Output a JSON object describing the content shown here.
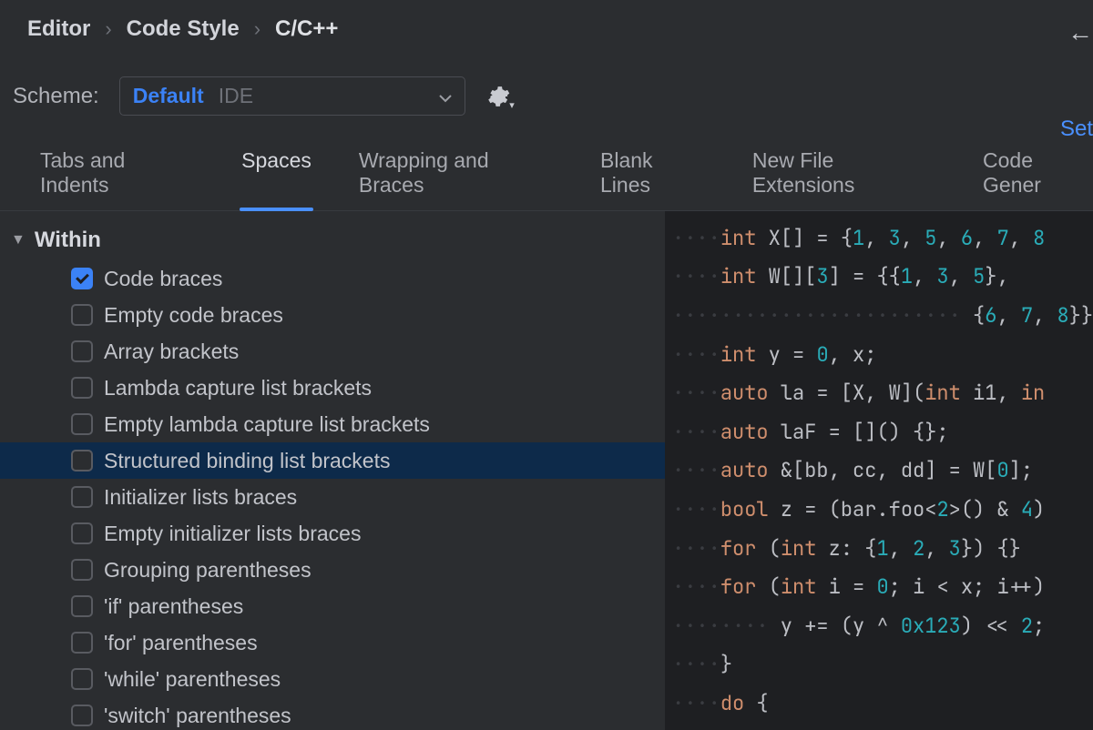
{
  "breadcrumb": [
    "Editor",
    "Code Style",
    "C/C++"
  ],
  "top_link": "Set",
  "scheme": {
    "label": "Scheme:",
    "primary": "Default",
    "secondary": "IDE"
  },
  "tabs": [
    {
      "label": "Tabs and Indents",
      "active": false
    },
    {
      "label": "Spaces",
      "active": true
    },
    {
      "label": "Wrapping and Braces",
      "active": false
    },
    {
      "label": "Blank Lines",
      "active": false
    },
    {
      "label": "New File Extensions",
      "active": false
    },
    {
      "label": "Code Gener",
      "active": false
    }
  ],
  "section_title": "Within",
  "options": [
    {
      "label": "Code braces",
      "checked": true,
      "selected": false
    },
    {
      "label": "Empty code braces",
      "checked": false,
      "selected": false
    },
    {
      "label": "Array brackets",
      "checked": false,
      "selected": false
    },
    {
      "label": "Lambda capture list brackets",
      "checked": false,
      "selected": false
    },
    {
      "label": "Empty lambda capture list brackets",
      "checked": false,
      "selected": false
    },
    {
      "label": "Structured binding list brackets",
      "checked": false,
      "selected": true
    },
    {
      "label": "Initializer lists braces",
      "checked": false,
      "selected": false
    },
    {
      "label": "Empty initializer lists braces",
      "checked": false,
      "selected": false
    },
    {
      "label": "Grouping parentheses",
      "checked": false,
      "selected": false
    },
    {
      "label": "'if' parentheses",
      "checked": false,
      "selected": false
    },
    {
      "label": "'for' parentheses",
      "checked": false,
      "selected": false
    },
    {
      "label": "'while' parentheses",
      "checked": false,
      "selected": false
    },
    {
      "label": "'switch' parentheses",
      "checked": false,
      "selected": false
    }
  ],
  "code": [
    {
      "indent": 1,
      "tokens": [
        [
          "kw",
          "int"
        ],
        [
          "txt",
          " X[] = {"
        ],
        [
          "num",
          "1"
        ],
        [
          "txt",
          ", "
        ],
        [
          "num",
          "3"
        ],
        [
          "txt",
          ", "
        ],
        [
          "num",
          "5"
        ],
        [
          "txt",
          ", "
        ],
        [
          "num",
          "6"
        ],
        [
          "txt",
          ", "
        ],
        [
          "num",
          "7"
        ],
        [
          "txt",
          ", "
        ],
        [
          "num",
          "8"
        ]
      ]
    },
    {
      "indent": 1,
      "tokens": [
        [
          "kw",
          "int"
        ],
        [
          "txt",
          " W[]["
        ],
        [
          "num",
          "3"
        ],
        [
          "txt",
          "] = {{"
        ],
        [
          "num",
          "1"
        ],
        [
          "txt",
          ", "
        ],
        [
          "num",
          "3"
        ],
        [
          "txt",
          ", "
        ],
        [
          "num",
          "5"
        ],
        [
          "txt",
          "},"
        ]
      ]
    },
    {
      "indent": 6,
      "tokens": [
        [
          "txt",
          " {"
        ],
        [
          "num",
          "6"
        ],
        [
          "txt",
          ", "
        ],
        [
          "num",
          "7"
        ],
        [
          "txt",
          ", "
        ],
        [
          "num",
          "8"
        ],
        [
          "txt",
          "}};"
        ]
      ]
    },
    {
      "indent": 1,
      "tokens": [
        [
          "kw",
          "int"
        ],
        [
          "txt",
          " y = "
        ],
        [
          "num",
          "0"
        ],
        [
          "txt",
          ", x;"
        ]
      ]
    },
    {
      "indent": 1,
      "tokens": [
        [
          "kw",
          "auto"
        ],
        [
          "txt",
          " la = [X, W]("
        ],
        [
          "kw",
          "int"
        ],
        [
          "txt",
          " i1, "
        ],
        [
          "kw",
          "in"
        ]
      ]
    },
    {
      "indent": 1,
      "tokens": [
        [
          "kw",
          "auto"
        ],
        [
          "txt",
          " laF = []() {};"
        ]
      ]
    },
    {
      "indent": 1,
      "tokens": [
        [
          "kw",
          "auto"
        ],
        [
          "txt",
          " &[bb, cc, dd] = W["
        ],
        [
          "num",
          "0"
        ],
        [
          "txt",
          "];"
        ]
      ]
    },
    {
      "indent": 1,
      "tokens": [
        [
          "kw",
          "bool"
        ],
        [
          "txt",
          " z = (bar.foo<"
        ],
        [
          "num",
          "2"
        ],
        [
          "txt",
          ">() & "
        ],
        [
          "num",
          "4"
        ],
        [
          "txt",
          ")"
        ]
      ]
    },
    {
      "indent": 1,
      "tokens": [
        [
          "kw",
          "for"
        ],
        [
          "txt",
          " ("
        ],
        [
          "kw",
          "int"
        ],
        [
          "txt",
          " z: {"
        ],
        [
          "num",
          "1"
        ],
        [
          "txt",
          ", "
        ],
        [
          "num",
          "2"
        ],
        [
          "txt",
          ", "
        ],
        [
          "num",
          "3"
        ],
        [
          "txt",
          "}) {}"
        ]
      ]
    },
    {
      "indent": 1,
      "tokens": [
        [
          "kw",
          "for"
        ],
        [
          "txt",
          " ("
        ],
        [
          "kw",
          "int"
        ],
        [
          "txt",
          " i = "
        ],
        [
          "num",
          "0"
        ],
        [
          "txt",
          "; i < x; i++)"
        ]
      ]
    },
    {
      "indent": 2,
      "tokens": [
        [
          "txt",
          " y += (y ^ "
        ],
        [
          "num",
          "0x123"
        ],
        [
          "txt",
          ") << "
        ],
        [
          "num",
          "2"
        ],
        [
          "txt",
          ";"
        ]
      ]
    },
    {
      "indent": 1,
      "tokens": [
        [
          "txt",
          "}"
        ]
      ]
    },
    {
      "indent": 1,
      "tokens": [
        [
          "kw",
          "do"
        ],
        [
          "txt",
          " {"
        ]
      ]
    }
  ]
}
